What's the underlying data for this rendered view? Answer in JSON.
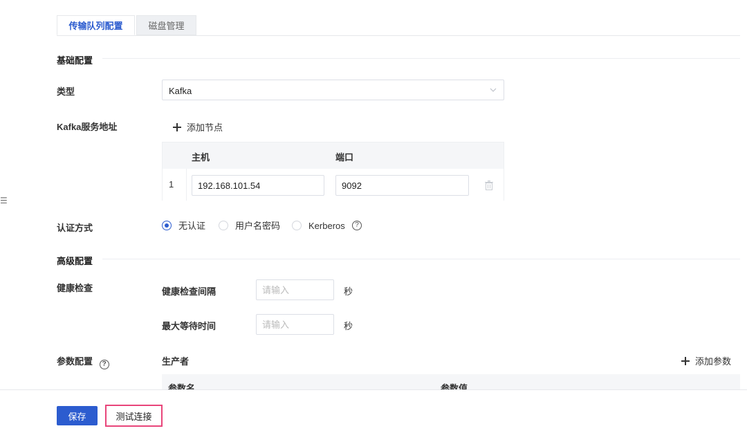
{
  "tabs": [
    {
      "label": "传输队列配置",
      "active": true
    },
    {
      "label": "磁盘管理",
      "active": false
    }
  ],
  "sections": {
    "basic": "基础配置",
    "advanced": "高级配置"
  },
  "type_field": {
    "label": "类型",
    "value": "Kafka"
  },
  "kafka_address": {
    "label": "Kafka服务地址",
    "add_node": "添加节点",
    "columns": [
      "主机",
      "端口"
    ],
    "rows": [
      {
        "index": "1",
        "host": "192.168.101.54",
        "port": "9092"
      }
    ]
  },
  "auth": {
    "label": "认证方式",
    "options": [
      "无认证",
      "用户名密码",
      "Kerberos"
    ],
    "selected": "无认证",
    "help": "?"
  },
  "health_check": {
    "label": "健康检查",
    "interval_label": "健康检查间隔",
    "interval_placeholder": "请输入",
    "interval_unit": "秒",
    "max_wait_label": "最大等待时间",
    "max_wait_placeholder": "请输入",
    "max_wait_unit": "秒"
  },
  "params": {
    "label": "参数配置",
    "help": "?",
    "producer_label": "生产者",
    "add_param": "添加参数",
    "columns": [
      "参数名",
      "参数值"
    ]
  },
  "footer": {
    "save": "保存",
    "test": "测试连接"
  },
  "edge_mark": "☰",
  "colors": {
    "primary": "#2c5ccf",
    "highlight_border": "#e8457a"
  }
}
